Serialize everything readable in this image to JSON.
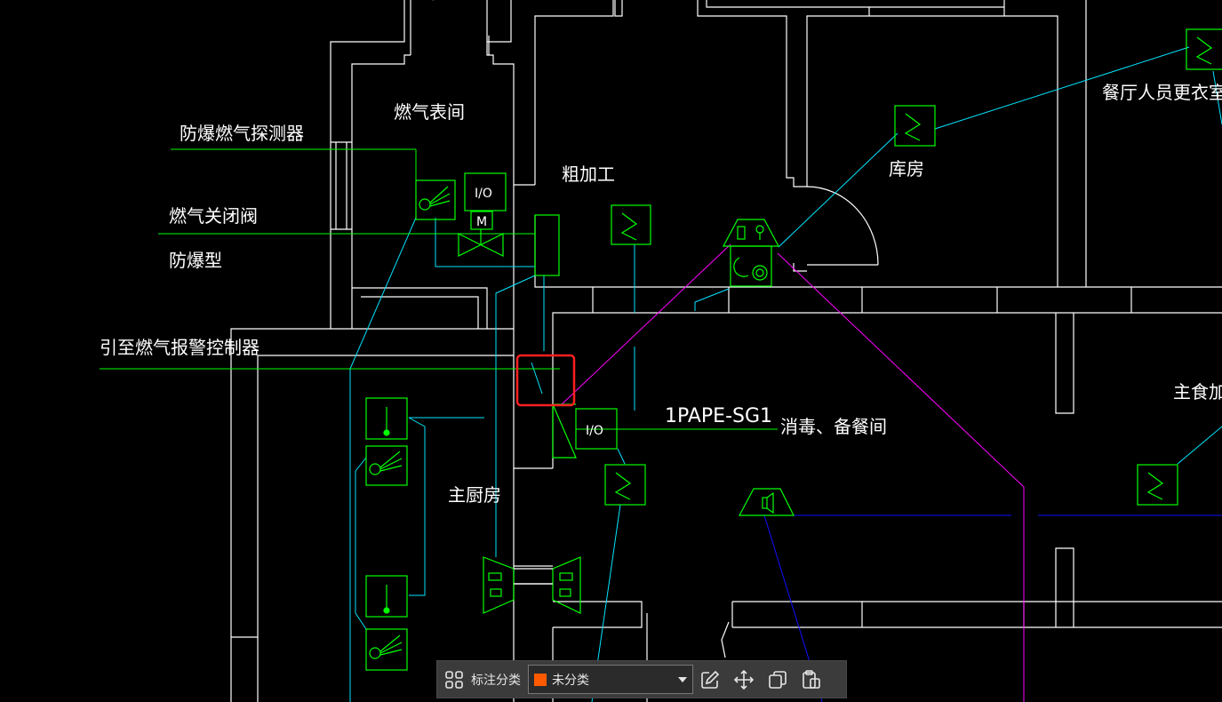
{
  "drawing": {
    "labels": {
      "gas_meter_room": "燃气表间",
      "explosion_proof_gas_detector": "防爆燃气探测器",
      "gas_shutoff_valve": "燃气关闭阀",
      "explosion_proof_type": "防爆型",
      "to_gas_alarm_controller": "引至燃气报警控制器",
      "rough_processing": "粗加工",
      "storage_room": "库房",
      "staff_changing_room": "餐厅人员更衣室",
      "main_kitchen": "主厨房",
      "disinfection_room": "消毒、备餐间",
      "staple_food_processing": "主食加工",
      "equipment_code": "1PAPE-SG1"
    },
    "symbols": {
      "io_module": "I/O",
      "motor_valve": "M"
    },
    "colors": {
      "background": "#000000",
      "walls": "#ffffff",
      "equipment": "#00ff00",
      "signal_line": "#00e5ff",
      "broadcast_line": "#ff00ff",
      "power_line": "#0000ff",
      "selection_box": "#ff2020"
    }
  },
  "toolbar": {
    "grid_icon": "grid-icon",
    "category_label": "标注分类",
    "category_value": "未分类",
    "category_color": "#ff5a00",
    "edit_icon": "edit-icon",
    "move_icon": "move-icon",
    "copy_icon": "copy-icon",
    "paste_icon": "paste-icon"
  }
}
